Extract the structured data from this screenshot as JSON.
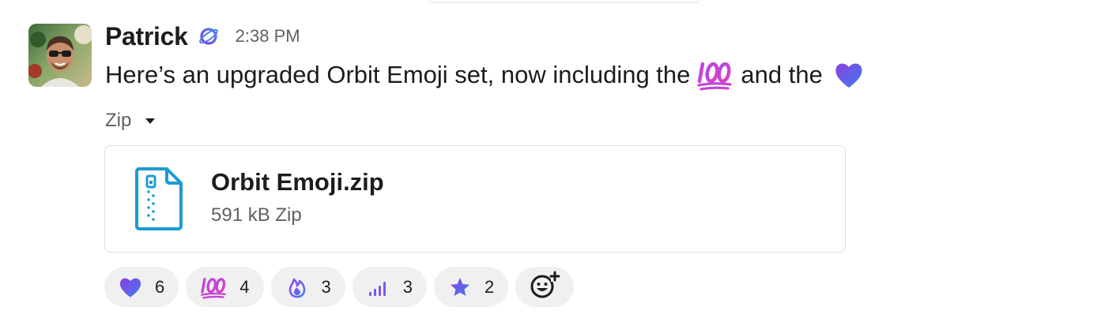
{
  "message": {
    "author": "Patrick",
    "timestamp": "2:38 PM",
    "text_before": "Here’s an upgraded Orbit Emoji set, now including the",
    "text_middle": "and the",
    "inline_emojis": [
      "emoji-100-icon",
      "emoji-purple-heart-icon"
    ]
  },
  "attachment": {
    "type_label": "Zip",
    "file_name": "Orbit Emoji.zip",
    "file_meta": "591 kB Zip",
    "icon": "zip-file-icon"
  },
  "reactions": [
    {
      "emoji": "purple-heart-icon",
      "count": "6"
    },
    {
      "emoji": "hundred-points-icon",
      "count": "4"
    },
    {
      "emoji": "fire-icon",
      "count": "3"
    },
    {
      "emoji": "bar-chart-icon",
      "count": "3"
    },
    {
      "emoji": "star-icon",
      "count": "2"
    }
  ],
  "add_reaction_icon": "add-reaction-icon",
  "colors": {
    "text": "#1d1c1d",
    "muted": "#616061",
    "accent_blue": "#1d9bd1",
    "gradient_purple": "#7b3fe4",
    "gradient_blue": "#4f7df0",
    "gradient_pink": "#d23bd6",
    "chip_bg": "#f0f0f0"
  }
}
